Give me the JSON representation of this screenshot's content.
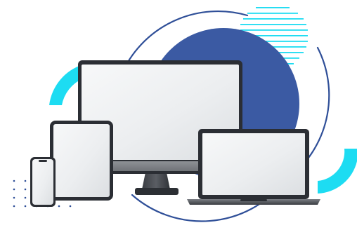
{
  "colors": {
    "background": "#ffffff",
    "circle": "#3b5aa3",
    "arc_stroke": "#2f4f98",
    "accent": "#1ddcf2",
    "dots": "#2f4f98",
    "device_frame": "#2b2e34",
    "screen_light": "#f5f6f7",
    "screen_shade": "#dfe1e4"
  },
  "illustration": {
    "devices": [
      "desktop-monitor",
      "laptop",
      "tablet",
      "smartphone"
    ],
    "decor": [
      "blue-circle",
      "outline-arcs",
      "cyan-ring-segments",
      "cyan-stripes",
      "dot-grid"
    ]
  }
}
